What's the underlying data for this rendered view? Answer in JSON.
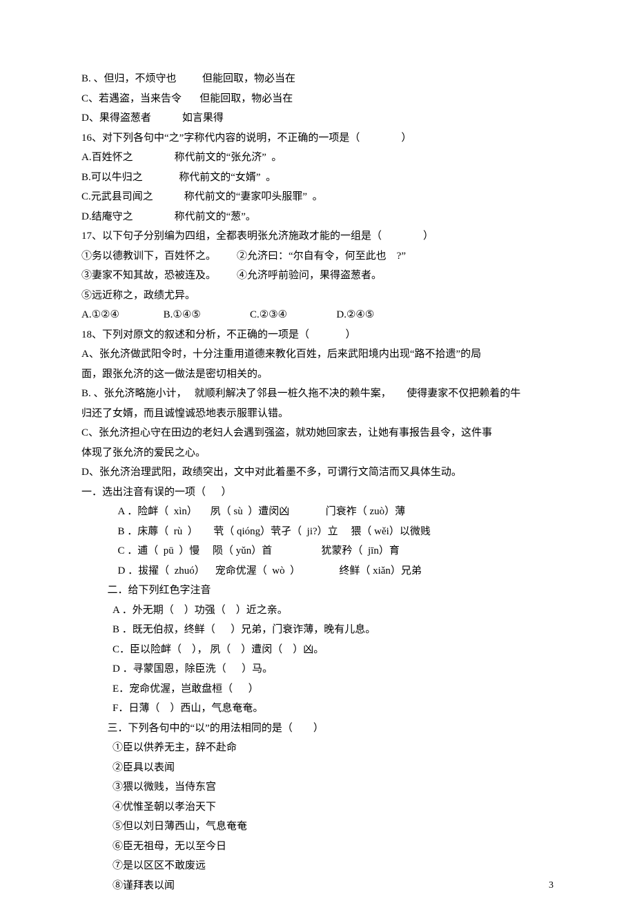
{
  "lines": {
    "l1": "B. 、但归，不烦守也          但能回取，物必当在",
    "l2": "C、若遇盗，当来告令       但能回取，物必当在",
    "l3": "D、果得盗葱者            如言果得",
    "l4": "16、对下列各句中“之”字称代内容的说明，不正确的一项是（                ）",
    "l5": "A.百姓怀之                称代前文的“张允济”  。",
    "l6": "B.可以牛归之              称代前文的“女婿”  。",
    "l7": "C.元武县司闻之            称代前文的“妻家叩头服罪”  。",
    "l8": "D.结庵守之                称代前文的“葱”。",
    "l9": "17、以下句子分别编为四组，全都表明张允济施政才能的一组是（                ）",
    "l10": "①务以德教训下，百姓怀之。        ②允济曰：“尔自有令，何至此也    ?”",
    "l11": "③妻家不知其故，恐被连及。        ④允济呼前验问，果得盗葱者。",
    "l12": "⑤远近称之，政绩尤异。",
    "l13": "A.①②④                 B.①④⑤                   C.②③④                   D.②④⑤",
    "l14": "18、下列对原文的叙述和分析，不正确的一项是（              ）",
    "l15": "A、张允济做武阳令时，十分注重用道德来教化百姓，后来武阳境内出现“路不拾遗”的局",
    "l16": "面，跟张允济的这一做法是密切相关的。",
    "l17": "B. 、张允济略施小计，   就顺利解决了邻县一桩久拖不决的赖牛案，      使得妻家不仅把赖着的牛",
    "l18": "归还了女婿，而且诚惶诚恐地表示服罪认错。",
    "l19": "C、张允济担心守在田边的老妇人会遇到强盗，就劝她回家去，让她有事报告县令，这件事",
    "l20": "体现了张允济的爱民之心。",
    "l21": "D、张允济治理武阳，政绩突出，文中对此着墨不多，可谓行文简洁而又具体生动。",
    "l22": "一．选出注音有误的一项（      ）",
    "l23": "A ．险衅（  xìn）     夙（ sù  ）遭闵凶              门衰祚（ zuò）薄",
    "l24": "B ．床蓐（  rù  ）      茕（ qióng）茕孑（  ji?）立     猥（ wěi）以微贱",
    "l25": "C ．逋（  pū  ）慢     陨（ yǔn）首                   犹蒙矜（  jīn）育",
    "l26": "D ．拔擢（  zhuó）    宠命优渥（  wò  ）               终鲜（ xiǎn）兄弟",
    "l27": "",
    "l28": "二．给下列红色字注音",
    "l29": "A ．外无期（    ）功强（    ）近之亲。",
    "l30": "B ．既无伯叔，终鲜（      ）兄弟，门衰诈薄，晚有儿息。",
    "l31": "C．臣以险衅（    ）， 夙（    ）遭闵（    ）凶。",
    "l32": "D ．寻蒙国恩，除臣洗（      ）马。",
    "l33": "E．宠命优渥，岂敢盘桓（      ）",
    "l34": "F．日薄（    ）西山，气息奄奄。",
    "l35": "",
    "l36": "三．下列各句中的“以”的用法相同的是（        ）",
    "l37": "①臣以供养无主，辞不赴命",
    "l38": "②臣具以表闻",
    "l39": "③猥以微贱，当侍东宫",
    "l40": "④优惟圣朝以孝治天下",
    "l41": "⑤但以刘日薄西山，气息奄奄",
    "l42": "⑥臣无祖母，无以至今日",
    "l43": "⑦是以区区不敢废远",
    "l44": "⑧谨拜表以闻"
  },
  "pageNumber": "3"
}
